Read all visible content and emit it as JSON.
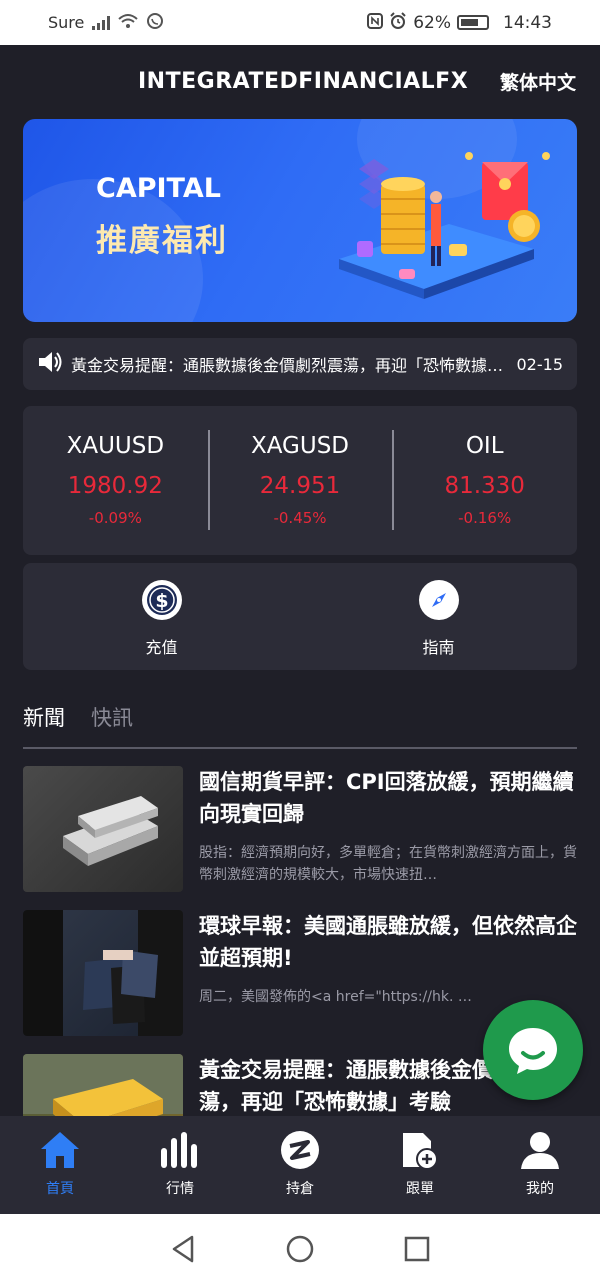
{
  "status_bar": {
    "carrier": "Sure",
    "battery": "62%",
    "time": "14:43"
  },
  "header": {
    "title": "INTEGRATEDFINANCIALFX",
    "language": "繁体中文"
  },
  "banner": {
    "line1": "CAPITAL",
    "line2": "推廣福利"
  },
  "ticker": {
    "text": "黃金交易提醒：通脹數據後金價劇烈震蕩，再迎「恐怖數據」考驗",
    "date": "02-15"
  },
  "quotes": [
    {
      "symbol": "XAUUSD",
      "price": "1980.92",
      "change": "-0.09%"
    },
    {
      "symbol": "XAGUSD",
      "price": "24.951",
      "change": "-0.45%"
    },
    {
      "symbol": "OIL",
      "price": "81.330",
      "change": "-0.16%"
    }
  ],
  "actions": [
    {
      "label": "充值",
      "icon": "dollar-icon"
    },
    {
      "label": "指南",
      "icon": "compass-icon"
    }
  ],
  "tabs": [
    {
      "label": "新聞",
      "active": true
    },
    {
      "label": "快訊",
      "active": false
    }
  ],
  "news": [
    {
      "title": "國信期貨早評：CPI回落放緩，預期繼續向現實回歸",
      "excerpt": "股指：經濟預期向好，多單輕倉；在貨幣刺激經濟方面上，貨幣刺激經濟的規模較大，市場快速扭…"
    },
    {
      "title": "環球早報：美國通脹雖放緩，但依然高企並超預期!",
      "excerpt": "周二，美國發佈的<a href=\"https://hk. …"
    },
    {
      "title": "黃金交易提醒：通脹數據後金價劇烈震蕩，再迎「恐怖數據」考驗",
      "excerpt": ""
    }
  ],
  "bottom_nav": [
    {
      "label": "首頁",
      "icon": "home-icon",
      "active": true
    },
    {
      "label": "行情",
      "icon": "chart-bars-icon",
      "active": false
    },
    {
      "label": "持倉",
      "icon": "position-icon",
      "active": false
    },
    {
      "label": "跟單",
      "icon": "copy-trade-icon",
      "active": false
    },
    {
      "label": "我的",
      "icon": "profile-icon",
      "active": false
    }
  ],
  "colors": {
    "background": "#1f1f28",
    "card": "#2c2c37",
    "negative": "#e8293a",
    "accent": "#2f7ef5",
    "chat": "#1f9a4c"
  }
}
